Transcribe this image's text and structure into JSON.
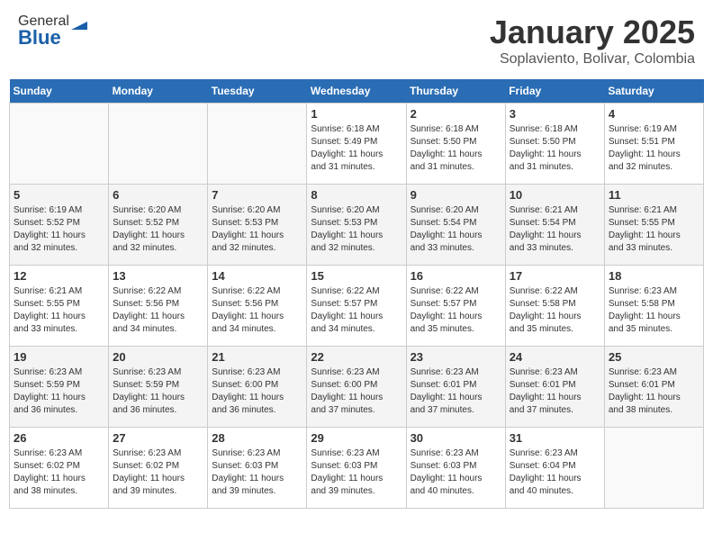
{
  "header": {
    "logo_general": "General",
    "logo_blue": "Blue",
    "month_title": "January 2025",
    "location": "Soplaviento, Bolivar, Colombia"
  },
  "weekdays": [
    "Sunday",
    "Monday",
    "Tuesday",
    "Wednesday",
    "Thursday",
    "Friday",
    "Saturday"
  ],
  "weeks": [
    [
      {
        "day": "",
        "info": ""
      },
      {
        "day": "",
        "info": ""
      },
      {
        "day": "",
        "info": ""
      },
      {
        "day": "1",
        "info": "Sunrise: 6:18 AM\nSunset: 5:49 PM\nDaylight: 11 hours\nand 31 minutes."
      },
      {
        "day": "2",
        "info": "Sunrise: 6:18 AM\nSunset: 5:50 PM\nDaylight: 11 hours\nand 31 minutes."
      },
      {
        "day": "3",
        "info": "Sunrise: 6:18 AM\nSunset: 5:50 PM\nDaylight: 11 hours\nand 31 minutes."
      },
      {
        "day": "4",
        "info": "Sunrise: 6:19 AM\nSunset: 5:51 PM\nDaylight: 11 hours\nand 32 minutes."
      }
    ],
    [
      {
        "day": "5",
        "info": "Sunrise: 6:19 AM\nSunset: 5:52 PM\nDaylight: 11 hours\nand 32 minutes."
      },
      {
        "day": "6",
        "info": "Sunrise: 6:20 AM\nSunset: 5:52 PM\nDaylight: 11 hours\nand 32 minutes."
      },
      {
        "day": "7",
        "info": "Sunrise: 6:20 AM\nSunset: 5:53 PM\nDaylight: 11 hours\nand 32 minutes."
      },
      {
        "day": "8",
        "info": "Sunrise: 6:20 AM\nSunset: 5:53 PM\nDaylight: 11 hours\nand 32 minutes."
      },
      {
        "day": "9",
        "info": "Sunrise: 6:20 AM\nSunset: 5:54 PM\nDaylight: 11 hours\nand 33 minutes."
      },
      {
        "day": "10",
        "info": "Sunrise: 6:21 AM\nSunset: 5:54 PM\nDaylight: 11 hours\nand 33 minutes."
      },
      {
        "day": "11",
        "info": "Sunrise: 6:21 AM\nSunset: 5:55 PM\nDaylight: 11 hours\nand 33 minutes."
      }
    ],
    [
      {
        "day": "12",
        "info": "Sunrise: 6:21 AM\nSunset: 5:55 PM\nDaylight: 11 hours\nand 33 minutes."
      },
      {
        "day": "13",
        "info": "Sunrise: 6:22 AM\nSunset: 5:56 PM\nDaylight: 11 hours\nand 34 minutes."
      },
      {
        "day": "14",
        "info": "Sunrise: 6:22 AM\nSunset: 5:56 PM\nDaylight: 11 hours\nand 34 minutes."
      },
      {
        "day": "15",
        "info": "Sunrise: 6:22 AM\nSunset: 5:57 PM\nDaylight: 11 hours\nand 34 minutes."
      },
      {
        "day": "16",
        "info": "Sunrise: 6:22 AM\nSunset: 5:57 PM\nDaylight: 11 hours\nand 35 minutes."
      },
      {
        "day": "17",
        "info": "Sunrise: 6:22 AM\nSunset: 5:58 PM\nDaylight: 11 hours\nand 35 minutes."
      },
      {
        "day": "18",
        "info": "Sunrise: 6:23 AM\nSunset: 5:58 PM\nDaylight: 11 hours\nand 35 minutes."
      }
    ],
    [
      {
        "day": "19",
        "info": "Sunrise: 6:23 AM\nSunset: 5:59 PM\nDaylight: 11 hours\nand 36 minutes."
      },
      {
        "day": "20",
        "info": "Sunrise: 6:23 AM\nSunset: 5:59 PM\nDaylight: 11 hours\nand 36 minutes."
      },
      {
        "day": "21",
        "info": "Sunrise: 6:23 AM\nSunset: 6:00 PM\nDaylight: 11 hours\nand 36 minutes."
      },
      {
        "day": "22",
        "info": "Sunrise: 6:23 AM\nSunset: 6:00 PM\nDaylight: 11 hours\nand 37 minutes."
      },
      {
        "day": "23",
        "info": "Sunrise: 6:23 AM\nSunset: 6:01 PM\nDaylight: 11 hours\nand 37 minutes."
      },
      {
        "day": "24",
        "info": "Sunrise: 6:23 AM\nSunset: 6:01 PM\nDaylight: 11 hours\nand 37 minutes."
      },
      {
        "day": "25",
        "info": "Sunrise: 6:23 AM\nSunset: 6:01 PM\nDaylight: 11 hours\nand 38 minutes."
      }
    ],
    [
      {
        "day": "26",
        "info": "Sunrise: 6:23 AM\nSunset: 6:02 PM\nDaylight: 11 hours\nand 38 minutes."
      },
      {
        "day": "27",
        "info": "Sunrise: 6:23 AM\nSunset: 6:02 PM\nDaylight: 11 hours\nand 39 minutes."
      },
      {
        "day": "28",
        "info": "Sunrise: 6:23 AM\nSunset: 6:03 PM\nDaylight: 11 hours\nand 39 minutes."
      },
      {
        "day": "29",
        "info": "Sunrise: 6:23 AM\nSunset: 6:03 PM\nDaylight: 11 hours\nand 39 minutes."
      },
      {
        "day": "30",
        "info": "Sunrise: 6:23 AM\nSunset: 6:03 PM\nDaylight: 11 hours\nand 40 minutes."
      },
      {
        "day": "31",
        "info": "Sunrise: 6:23 AM\nSunset: 6:04 PM\nDaylight: 11 hours\nand 40 minutes."
      },
      {
        "day": "",
        "info": ""
      }
    ]
  ]
}
